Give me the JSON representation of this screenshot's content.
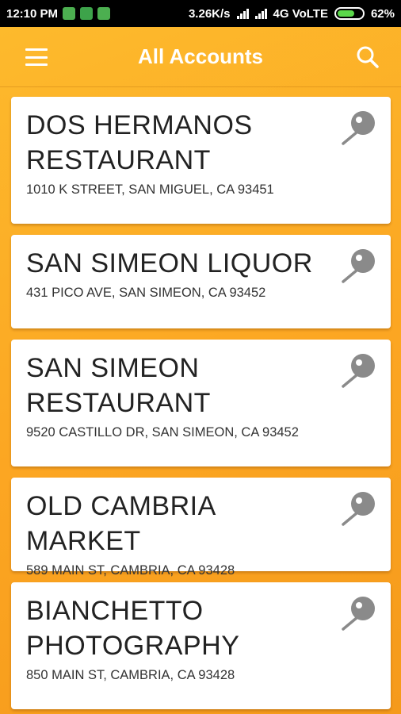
{
  "status_bar": {
    "time": "12:10 PM",
    "speed": "3.26K/s",
    "network": "4G VoLTE",
    "battery": "62%",
    "battery_level": 0.62
  },
  "app_bar": {
    "title": "All Accounts",
    "menu_icon": "hamburger-menu-icon",
    "search_icon": "search-icon"
  },
  "accounts": [
    {
      "name": "DOS HERMANOS\nRESTAURANT",
      "address": "1010 K STREET, SAN MIGUEL, CA 93451"
    },
    {
      "name": "SAN SIMEON LIQUOR",
      "address": "431 PICO AVE, SAN SIMEON, CA 93452"
    },
    {
      "name": "SAN SIMEON\nRESTAURANT",
      "address": "9520 CASTILLO DR, SAN SIMEON, CA 93452"
    },
    {
      "name": "OLD CAMBRIA MARKET",
      "address": "589 MAIN ST, CAMBRIA, CA 93428"
    },
    {
      "name": "BIANCHETTO\nPHOTOGRAPHY",
      "address": "850 MAIN ST, CAMBRIA, CA 93428"
    }
  ],
  "colors": {
    "accent": "#fca622",
    "pin_gray": "#8a8a8a"
  }
}
